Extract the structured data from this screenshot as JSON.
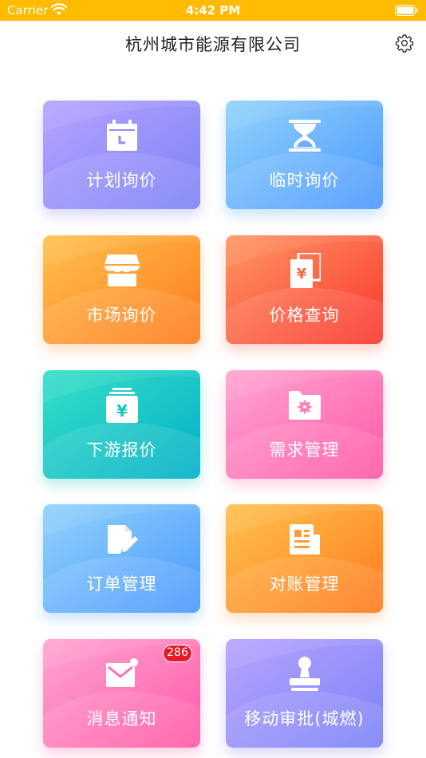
{
  "status_bar": {
    "carrier": "Carrier",
    "time": "4:42 PM"
  },
  "header": {
    "title": "杭州城市能源有限公司"
  },
  "tiles": [
    {
      "label": "计划询价",
      "icon": "calendar-icon"
    },
    {
      "label": "临时询价",
      "icon": "hourglass-icon"
    },
    {
      "label": "市场询价",
      "icon": "shop-awning-icon"
    },
    {
      "label": "价格查询",
      "icon": "yuan-document-icon"
    },
    {
      "label": "下游报价",
      "icon": "yuan-stack-icon"
    },
    {
      "label": "需求管理",
      "icon": "folder-gear-icon"
    },
    {
      "label": "订单管理",
      "icon": "edit-document-icon"
    },
    {
      "label": "对账管理",
      "icon": "ledger-icon"
    },
    {
      "label": "消息通知",
      "icon": "mail-notification-icon"
    },
    {
      "label": "移动审批(城燃)",
      "icon": "stamp-icon"
    }
  ],
  "notification_badge": "286",
  "colors": {
    "status_bar": "#ffbb00",
    "purple": [
      "#b3a2ff",
      "#7f84f7"
    ],
    "blue": [
      "#8fd0fb",
      "#4b9bfe"
    ],
    "orange": [
      "#ffbf4d",
      "#ff7d1f"
    ],
    "red": [
      "#ff9060",
      "#fb3b2e"
    ],
    "teal": [
      "#33dec5",
      "#00b2c8"
    ],
    "pink": [
      "#ffa0d0",
      "#ff5ba8"
    ],
    "badge": "#e21b2a"
  }
}
